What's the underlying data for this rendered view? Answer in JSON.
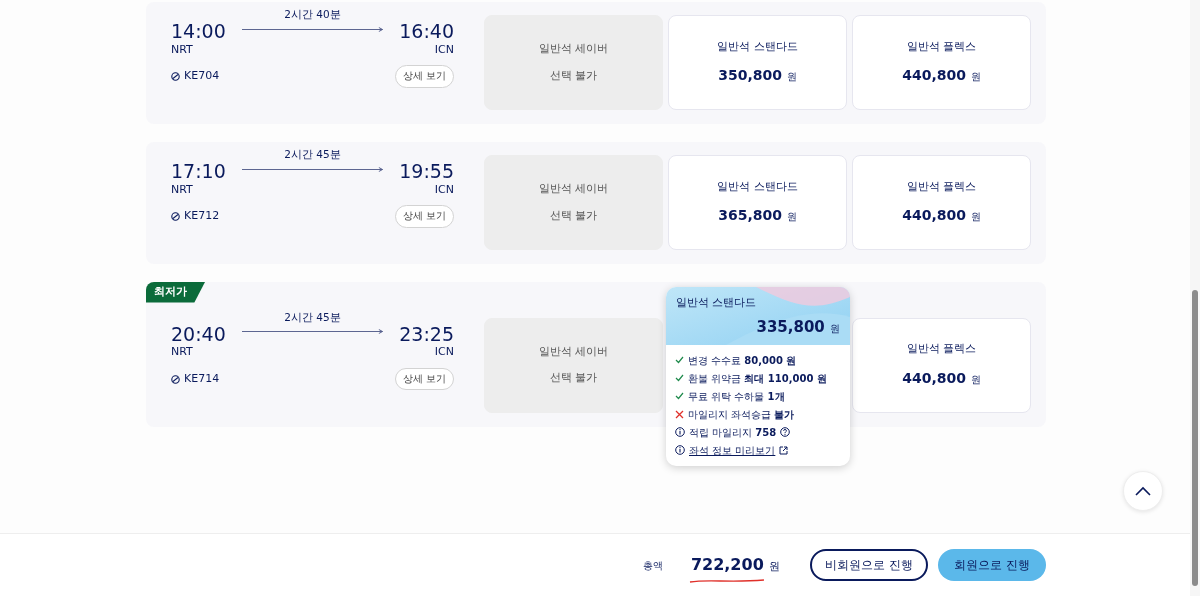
{
  "flights": [
    {
      "duration": "2시간 40분",
      "departure": {
        "time": "14:00",
        "airport": "NRT"
      },
      "arrival": {
        "time": "16:40",
        "airport": "ICN"
      },
      "flight_no": "KE704",
      "details_button": "상세 보기",
      "fares": [
        {
          "kind": "unavailable",
          "name": "일반석 세이버",
          "note": "선택 불가"
        },
        {
          "kind": "price",
          "name": "일반석 스탠다드",
          "price": "350,800",
          "currency": "원"
        },
        {
          "kind": "price",
          "name": "일반석 플렉스",
          "price": "440,800",
          "currency": "원"
        }
      ]
    },
    {
      "duration": "2시간 45분",
      "departure": {
        "time": "17:10",
        "airport": "NRT"
      },
      "arrival": {
        "time": "19:55",
        "airport": "ICN"
      },
      "flight_no": "KE712",
      "details_button": "상세 보기",
      "fares": [
        {
          "kind": "unavailable",
          "name": "일반석 세이버",
          "note": "선택 불가"
        },
        {
          "kind": "price",
          "name": "일반석 스탠다드",
          "price": "365,800",
          "currency": "원"
        },
        {
          "kind": "price",
          "name": "일반석 플렉스",
          "price": "440,800",
          "currency": "원"
        }
      ]
    },
    {
      "badge": "최저가",
      "duration": "2시간 45분",
      "departure": {
        "time": "20:40",
        "airport": "NRT"
      },
      "arrival": {
        "time": "23:25",
        "airport": "ICN"
      },
      "flight_no": "KE714",
      "details_button": "상세 보기",
      "fares": [
        {
          "kind": "unavailable",
          "name": "일반석 세이버",
          "note": "선택 불가"
        },
        {
          "kind": "detail",
          "name": "일반석 스탠다드",
          "price": "335,800",
          "currency": "원",
          "items": [
            {
              "kind": "included",
              "text": "변경 수수료 **80,000 원**"
            },
            {
              "kind": "included",
              "text": "환불 위약금 **최대 110,000 원**"
            },
            {
              "kind": "included",
              "text": "무료 위탁 수하물 **1개**"
            },
            {
              "kind": "excluded",
              "text": "마일리지 좌석승급 **불가**"
            },
            {
              "kind": "info",
              "text": "적립 마일리지 **758**"
            },
            {
              "kind": "link",
              "text": "좌석 정보 미리보기"
            }
          ]
        },
        {
          "kind": "price",
          "name": "일반석 플렉스",
          "price": "440,800",
          "currency": "원"
        }
      ]
    }
  ],
  "footer": {
    "total_label": "총액",
    "total": "722,200",
    "currency": "원",
    "buttons": [
      {
        "kind": "outline",
        "label": "비회원으로 진행"
      },
      {
        "kind": "primary",
        "label": "회원으로 진행"
      }
    ]
  }
}
